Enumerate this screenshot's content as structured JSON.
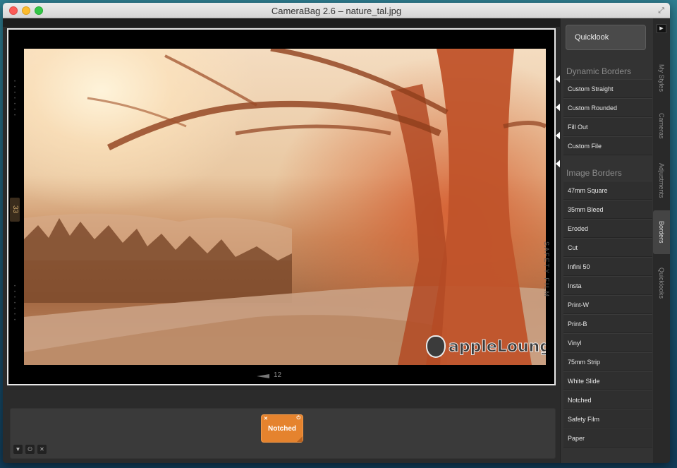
{
  "window": {
    "title": "CameraBag 2.6 – nature_tal.jpg"
  },
  "photo": {
    "frame_number_left": "33",
    "frame_number_bottom": "12",
    "edge_text": "SAFETY FILM",
    "watermark": "appleLounge",
    "watermark_prefix": "the"
  },
  "style_chip": {
    "label": "Notched",
    "close": "✕",
    "power": "⏻"
  },
  "tray_buttons": {
    "menu": "▼",
    "power": "⏻",
    "close": "✕"
  },
  "sidebar": {
    "quicklook_label": "Quicklook",
    "dynamic_borders": {
      "title": "Dynamic Borders",
      "items": [
        "Custom Straight",
        "Custom Rounded",
        "Fill Out",
        "Custom File"
      ]
    },
    "image_borders": {
      "title": "Image Borders",
      "items": [
        "47mm Square",
        "35mm Bleed",
        "Eroded",
        "Cut",
        "Infini 50",
        "Insta",
        "Print-W",
        "Print-B",
        "Vinyl",
        "75mm Strip",
        "White Slide",
        "Notched",
        "Safety Film",
        "Paper"
      ]
    }
  },
  "tabs": {
    "toggle": "▶",
    "items": [
      "My Styles",
      "Cameras",
      "Adjustments",
      "Borders",
      "Quicklooks"
    ],
    "active": "Borders"
  },
  "colors": {
    "accent": "#e5832e",
    "panel": "#333333",
    "background": "#2b2b2b"
  }
}
